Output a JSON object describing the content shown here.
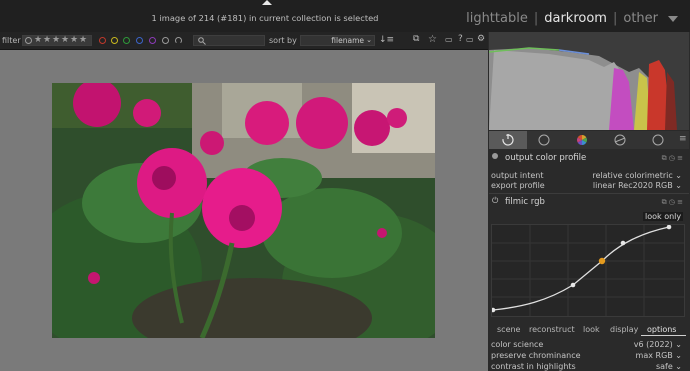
{
  "header": {
    "status": "1 image of 214 (#181) in current collection is selected",
    "views": {
      "lighttable": "lighttable",
      "darkroom": "darkroom",
      "other": "other",
      "separator": "|"
    }
  },
  "toolbar": {
    "filter_label": "filter",
    "sort_label": "sort by",
    "sort_value": "filename",
    "color_labels": [
      "#c0392b",
      "#c8b81e",
      "#2e9b3a",
      "#3b64c9",
      "#8c3bb8"
    ]
  },
  "right_panel": {
    "output_color_profile": {
      "title": "output color profile",
      "output_intent_label": "output intent",
      "output_intent_value": "relative colorimetric",
      "export_profile_label": "export profile",
      "export_profile_value": "linear Rec2020 RGB"
    },
    "filmic": {
      "title": "filmic rgb",
      "look_only": "look only",
      "tabs": [
        "scene",
        "reconstruct",
        "look",
        "display",
        "options"
      ],
      "active_tab": "options",
      "color_science_label": "color science",
      "color_science_value": "v6 (2022)",
      "preserve_chrominance_label": "preserve chrominance",
      "preserve_chrominance_value": "max RGB",
      "contrast_highlights_label": "contrast in highlights",
      "contrast_highlights_value": "safe"
    }
  }
}
